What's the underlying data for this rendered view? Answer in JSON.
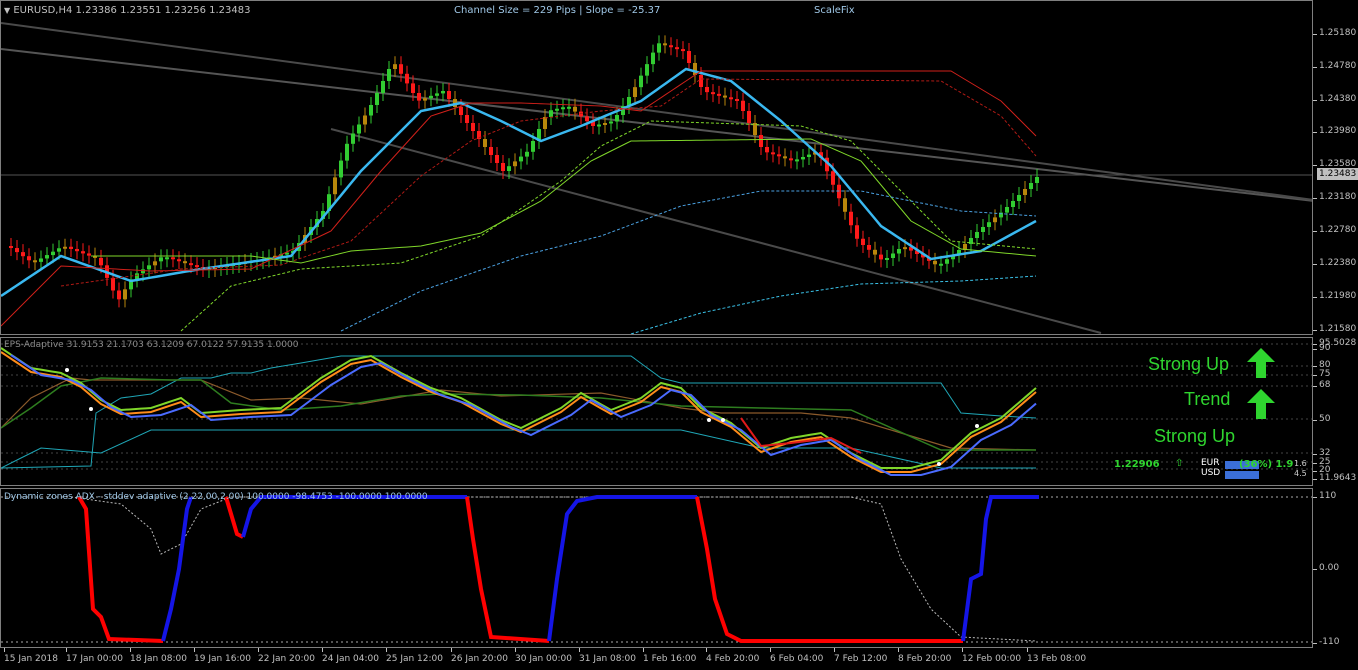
{
  "symbol_header": "EURUSD,H4  1.23386 1.23551 1.23256 1.23483",
  "channel_info": "Channel Size = 229 Pips  |  Slope = -25.37",
  "scalefix": "ScaleFix",
  "current_price": "1.23483",
  "price_scale": [
    "1.25180",
    "1.24780",
    "1.24380",
    "1.23980",
    "1.23580",
    "1.23180",
    "1.22780",
    "1.22380",
    "1.21980",
    "1.21580"
  ],
  "ind1_title": "EPS-Adaptive 31.9153 21.1703 63.1209 67.0122 57.9135 1.0000",
  "ind1_scale": [
    "95.5028",
    "90",
    "80",
    "75",
    "68",
    "50",
    "32",
    "25",
    "20",
    "11.9643"
  ],
  "ind2_title": "Dynamic zones ADX - stddev adaptive (2.22,00,2.00) 100.0000 -98.4753 -100.0000 100.0000",
  "ind2_scale": [
    "110",
    "0.00",
    "-110"
  ],
  "signals": {
    "strong_up_1": "Strong Up",
    "trend": "Trend",
    "strong_up_2": "Strong Up"
  },
  "currency_panel": {
    "price": "1.22906",
    "eur": "EUR",
    "usd": "USD",
    "pct": "(36%) 1.9",
    "v1": "1.6",
    "v2": "4.5"
  },
  "time_axis": [
    "15 Jan 2018",
    "17 Jan 00:00",
    "18 Jan 08:00",
    "19 Jan 16:00",
    "22 Jan 20:00",
    "24 Jan 04:00",
    "25 Jan 12:00",
    "26 Jan 20:00",
    "30 Jan 00:00",
    "31 Jan 08:00",
    "1 Feb 16:00",
    "4 Feb 20:00",
    "6 Feb 04:00",
    "7 Feb 12:00",
    "8 Feb 20:00",
    "12 Feb 00:00",
    "13 Feb 08:00"
  ],
  "colors": {
    "bull": "#32cd32",
    "bear": "#ff1a1a",
    "mid": "#b8860b",
    "ma": "#3ab8f0",
    "adx_up": "#1515e6",
    "adx_down": "#ff0000"
  }
}
